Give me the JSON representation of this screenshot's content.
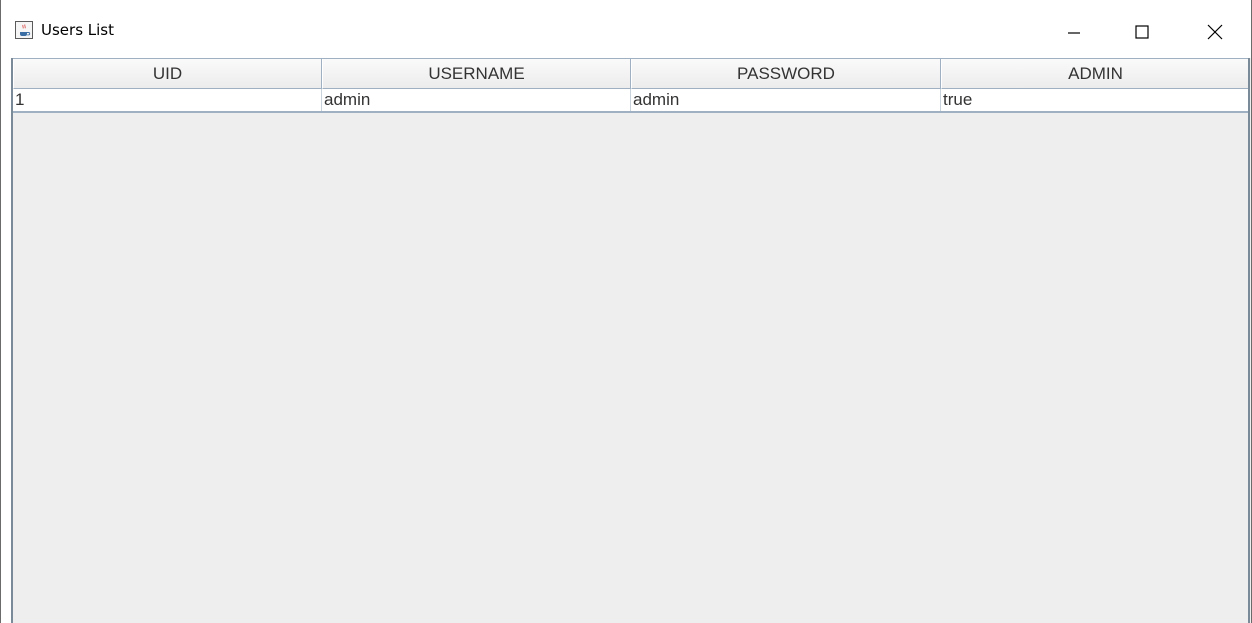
{
  "window": {
    "title": "Users List",
    "icon": "java-cup-icon",
    "controls": {
      "minimize": "minimize-icon",
      "maximize": "maximize-icon",
      "close": "close-icon"
    }
  },
  "table": {
    "columns": [
      "UID",
      "USERNAME",
      "PASSWORD",
      "ADMIN"
    ],
    "rows": [
      [
        "1",
        "admin",
        "admin",
        "true"
      ]
    ]
  },
  "colors": {
    "background": "#eeeeee",
    "header_border": "#9eb0c2",
    "text": "#333333"
  }
}
